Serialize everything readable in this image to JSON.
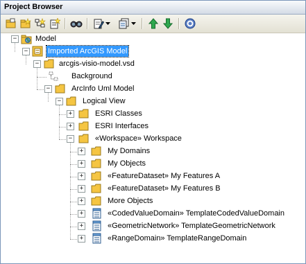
{
  "window": {
    "title": "Project Browser"
  },
  "toolbar": {
    "buttons": [
      "open-package-icon",
      "new-package-icon",
      "new-diagram-icon",
      "new-element-icon",
      "find-icon",
      "edit-options-icon",
      "view-options-icon",
      "move-up-icon",
      "move-down-icon",
      "help-icon"
    ]
  },
  "tree": {
    "model": "Model",
    "imported": "Imported ArcGIS Model",
    "vsd": "arcgis-visio-model.vsd",
    "background": "Background",
    "arcinfo": "ArcInfo Uml Model",
    "logical_view": "Logical View",
    "esri_classes": "ESRI Classes",
    "esri_interfaces": "ESRI Interfaces",
    "workspace": "«Workspace» Workspace",
    "my_domains": "My Domains",
    "my_objects": "My Objects",
    "feature_a": "«FeatureDataset» My Features A",
    "feature_b": "«FeatureDataset» My Features B",
    "more_objects": "More Objects",
    "coded_value": "«CodedValueDomain» TemplateCodedValueDomain",
    "geometric": "«GeometricNetwork» TemplateGeometricNetwork",
    "range": "«RangeDomain» TemplateRangeDomain"
  },
  "colors": {
    "selection": "#3399ff",
    "folder": "#f5c542"
  }
}
